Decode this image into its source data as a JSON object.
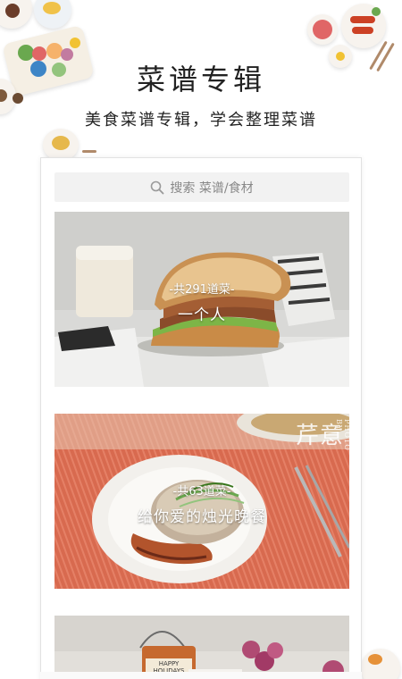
{
  "header": {
    "title": "菜谱专辑",
    "subtitle": "美食菜谱专辑，学会整理菜谱"
  },
  "search": {
    "placeholder": "搜索  菜谱/食材",
    "icon": "search-icon"
  },
  "albums": [
    {
      "count": "-共291道菜-",
      "title": "一个人"
    },
    {
      "count": "-共63道菜-",
      "title": "给你爱的烛光晚餐",
      "watermark": "芹意",
      "watermark_small": "PHOTO BY"
    },
    {
      "count": "",
      "title": "",
      "sign_text": "HAPPY HOLIDAYS"
    }
  ],
  "colors": {
    "accent_warm": "#e98a5b",
    "tablecloth": "#d96e52",
    "search_bg": "#f2f2f2"
  }
}
